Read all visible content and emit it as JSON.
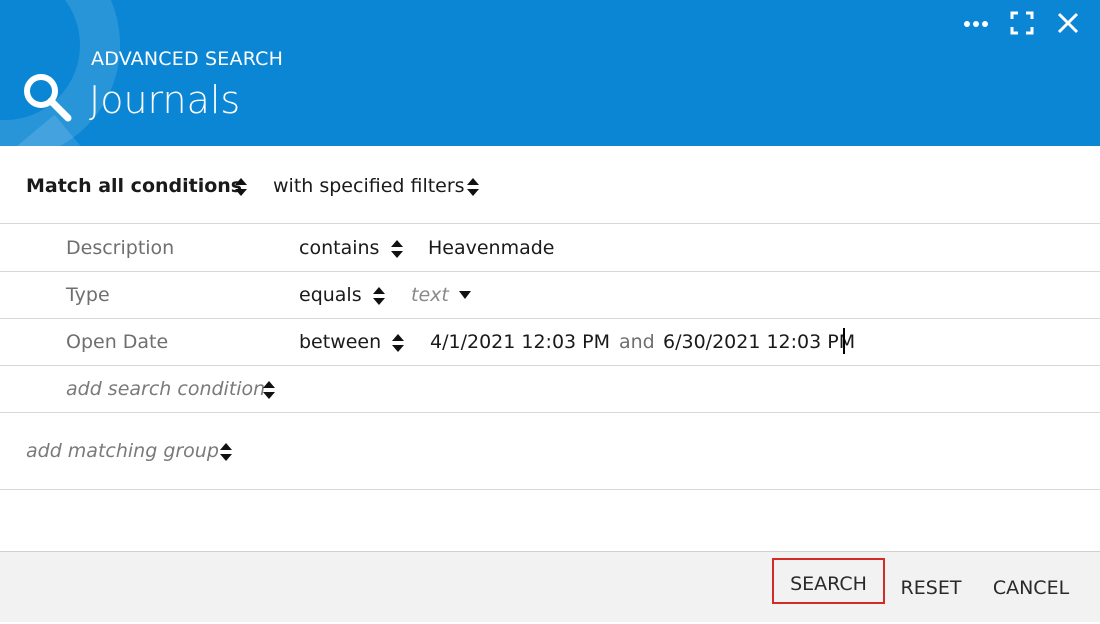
{
  "header": {
    "subtitle": "ADVANCED SEARCH",
    "title": "Journals",
    "color": "#0a86d4"
  },
  "window_controls": {
    "more_icon": "more-horizontal-icon",
    "fullscreen_icon": "fullscreen-icon",
    "close_icon": "close-icon"
  },
  "match": {
    "mode": "Match all conditions",
    "filter": "with specified filters"
  },
  "conditions": [
    {
      "field": "Description",
      "operator": "contains",
      "value": "Heavenmade"
    },
    {
      "field": "Type",
      "operator": "equals",
      "value_placeholder": "text"
    },
    {
      "field": "Open Date",
      "operator": "between",
      "value_from": "4/1/2021 12:03 PM",
      "joiner": "and",
      "value_to": "6/30/2021 12:03 PM"
    }
  ],
  "add_condition": "add search condition",
  "add_group": "add matching group",
  "footer": {
    "search": "SEARCH",
    "reset": "RESET",
    "cancel": "CANCEL",
    "highlight_color": "#d42a2a"
  }
}
